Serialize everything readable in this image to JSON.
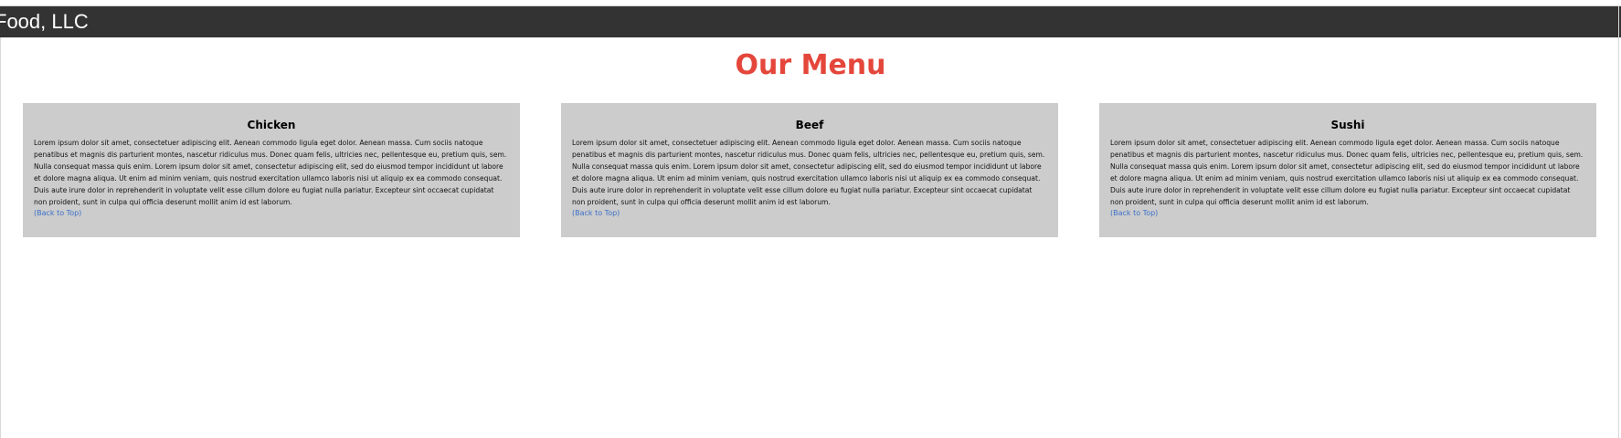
{
  "header": {
    "brand": "Food, LLC"
  },
  "main": {
    "title": "Our Menu",
    "cards": [
      {
        "title": "Chicken",
        "body": "Lorem ipsum dolor sit amet, consectetuer adipiscing elit. Aenean commodo ligula eget dolor. Aenean massa. Cum sociis natoque penatibus et magnis dis parturient montes, nascetur ridiculus mus. Donec quam felis, ultricies nec, pellentesque eu, pretium quis, sem. Nulla consequat massa quis enim. Lorem ipsum dolor sit amet, consectetur adipiscing elit, sed do eiusmod tempor incididunt ut labore et dolore magna aliqua. Ut enim ad minim veniam, quis nostrud exercitation ullamco laboris nisi ut aliquip ex ea commodo consequat. Duis aute irure dolor in reprehenderit in voluptate velit esse cillum dolore eu fugiat nulla pariatur. Excepteur sint occaecat cupidatat non proident, sunt in culpa qui officia deserunt mollit anim id est laborum.",
        "link": "(Back to Top)"
      },
      {
        "title": "Beef",
        "body": "Lorem ipsum dolor sit amet, consectetuer adipiscing elit. Aenean commodo ligula eget dolor. Aenean massa. Cum sociis natoque penatibus et magnis dis parturient montes, nascetur ridiculus mus. Donec quam felis, ultricies nec, pellentesque eu, pretium quis, sem. Nulla consequat massa quis enim. Lorem ipsum dolor sit amet, consectetur adipiscing elit, sed do eiusmod tempor incididunt ut labore et dolore magna aliqua. Ut enim ad minim veniam, quis nostrud exercitation ullamco laboris nisi ut aliquip ex ea commodo consequat. Duis aute irure dolor in reprehenderit in voluptate velit esse cillum dolore eu fugiat nulla pariatur. Excepteur sint occaecat cupidatat non proident, sunt in culpa qui officia deserunt mollit anim id est laborum.",
        "link": "(Back to Top)"
      },
      {
        "title": "Sushi",
        "body": "Lorem ipsum dolor sit amet, consectetuer adipiscing elit. Aenean commodo ligula eget dolor. Aenean massa. Cum sociis natoque penatibus et magnis dis parturient montes, nascetur ridiculus mus. Donec quam felis, ultricies nec, pellentesque eu, pretium quis, sem. Nulla consequat massa quis enim. Lorem ipsum dolor sit amet, consectetur adipiscing elit, sed do eiusmod tempor incididunt ut labore et dolore magna aliqua. Ut enim ad minim veniam, quis nostrud exercitation ullamco laboris nisi ut aliquip ex ea commodo consequat. Duis aute irure dolor in reprehenderit in voluptate velit esse cillum dolore eu fugiat nulla pariatur. Excepteur sint occaecat cupidatat non proident, sunt in culpa qui officia deserunt mollit anim id est laborum.",
        "link": "(Back to Top)"
      }
    ]
  },
  "colors": {
    "header_bg": "#333333",
    "title": "#e5463b",
    "card_bg": "#cccccc",
    "link": "#3b6fc9"
  }
}
